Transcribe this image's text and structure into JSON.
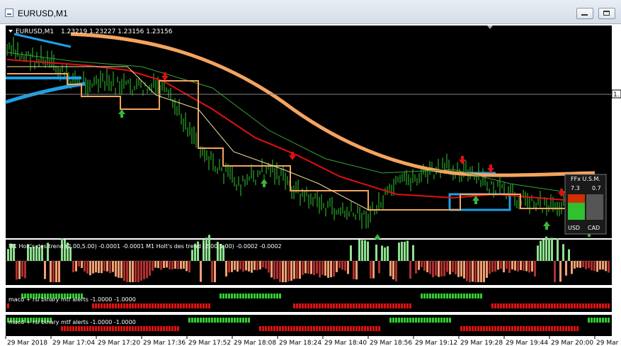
{
  "window": {
    "title": "EURUSD,M1"
  },
  "chart_header": {
    "symbol": "EURUSD,M1",
    "ohlc": "1.23219 1.23227 1.23156 1.23156"
  },
  "panels": {
    "holt": "M1 Holt's des trend (2.00,5.00) -0.0001 -0.0001 M1 Holt's des trend (2.00,5.00) -0.0002 -0.0002",
    "macd1": "macd + rsi binary mtf alerts -1.0000 -1.0000",
    "macd2": "macd + rsi binary mtf alerts -1.0000 -1.0000"
  },
  "time_axis": [
    "29 Mar 2018",
    "29 Mar 17:04",
    "29 Mar 17:20",
    "29 Mar 17:36",
    "29 Mar 17:52",
    "29 Mar 18:08",
    "29 Mar 18:24",
    "29 Mar 18:40",
    "29 Mar 18:56",
    "29 Mar 19:12",
    "29 Mar 19:28",
    "29 Mar 19:44",
    "29 Mar 20:00",
    "29 Mar 2"
  ],
  "price_marker": "1.",
  "meter": {
    "title": "FFx U.S.M.",
    "left_value": "7.3",
    "right_value": "0.7",
    "left_ccy": "USD",
    "right_ccy": "CAD"
  },
  "colors": {
    "bg": "#000000",
    "bull": "#32cd32",
    "slow_ma": "#f4a460",
    "fast_ma": "#e01010",
    "channel": "#1e90ff",
    "histo_green": "#8fe08f",
    "histo_red": "#b03030",
    "histo_orange": "#f4a070"
  }
}
